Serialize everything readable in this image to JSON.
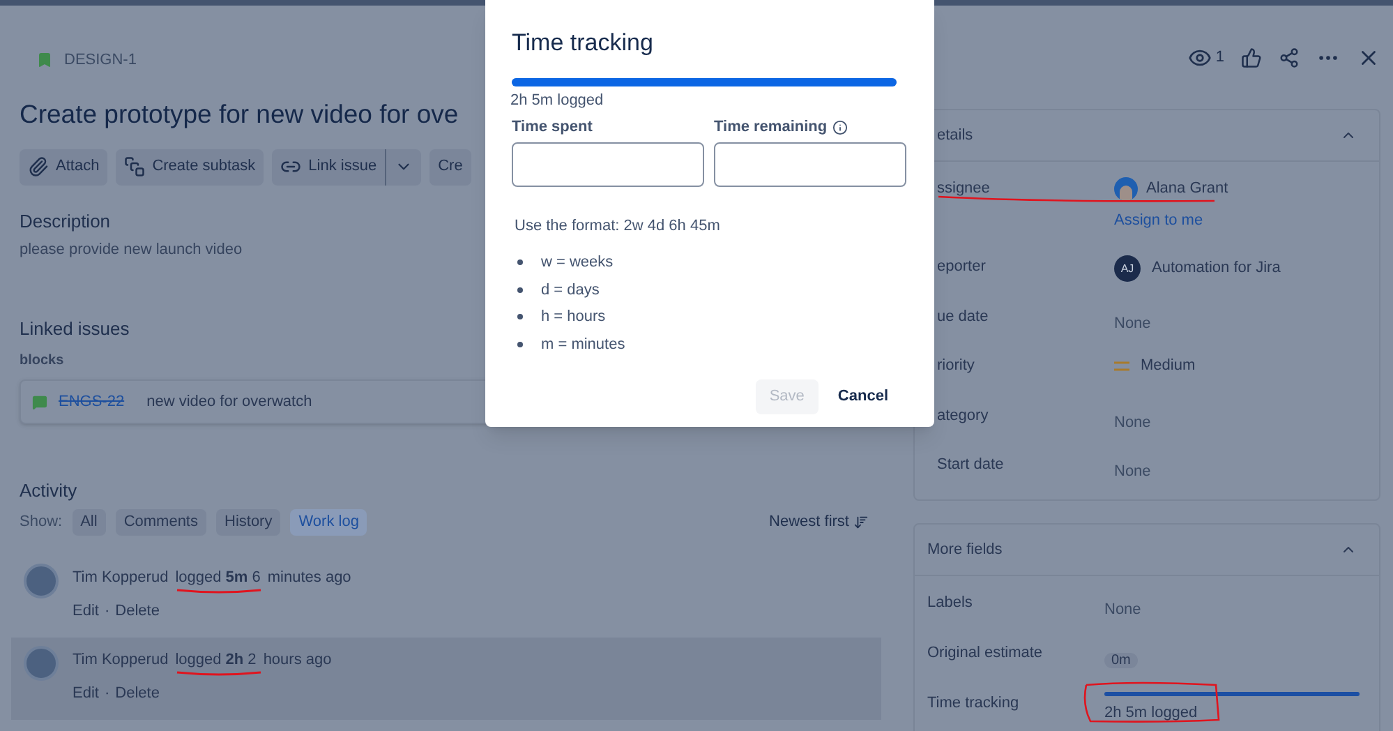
{
  "issue": {
    "key": "DESIGN-1",
    "title": "Create prototype for new video for ove"
  },
  "toolbar": [
    {
      "label": "Attach",
      "kind": "attach",
      "has_menu": false
    },
    {
      "label": "Create subtask",
      "kind": "subtask",
      "has_menu": false
    },
    {
      "label": "Link issue",
      "kind": "link",
      "has_menu": true
    },
    {
      "label": "Cre",
      "kind": "plain",
      "has_menu": false
    }
  ],
  "description": {
    "heading": "Description",
    "text": "please provide new launch video"
  },
  "linked_issues": {
    "heading": "Linked issues",
    "relation": "blocks",
    "items": [
      {
        "key": "ENGS-22",
        "summary": "new video for overwatch",
        "done": true
      }
    ]
  },
  "activity": {
    "heading": "Activity",
    "show_label": "Show:",
    "sort": "Newest first",
    "separator": "·",
    "filters": [
      {
        "label": "All",
        "selected": false
      },
      {
        "label": "Comments",
        "selected": false
      },
      {
        "label": "History",
        "selected": false
      },
      {
        "label": "Work log",
        "selected": true
      }
    ],
    "entries": [
      {
        "author": "Tim Kopperud",
        "action": "logged **5m** 6",
        "rest": "minutes ago",
        "underlined": true,
        "actions": [
          "Edit",
          "Delete"
        ]
      },
      {
        "author": "Tim Kopperud",
        "action": "logged **2h** 2",
        "rest": "hours ago",
        "underlined": true,
        "highlighted": true,
        "actions": [
          "Edit",
          "Delete"
        ]
      }
    ]
  },
  "header_actions": {
    "watchers": "1"
  },
  "details": {
    "heading": "etails",
    "expanded": true,
    "fields": [
      {
        "label": "ssignee",
        "kind": "user",
        "value": "Alana Grant",
        "link": "Assign to me",
        "underlined": true
      },
      {
        "label": "eporter",
        "kind": "initials",
        "initials": "AJ",
        "value": "Automation for Jira"
      },
      {
        "label": "ue date",
        "kind": "text",
        "value": "None"
      },
      {
        "label": "riority",
        "kind": "priority",
        "value": "Medium"
      },
      {
        "label": "ategory",
        "kind": "text",
        "value": "None"
      },
      {
        "label": "Start date",
        "kind": "text",
        "value": "None"
      }
    ]
  },
  "more_fields": {
    "heading": "More fields",
    "expanded": true,
    "fields": [
      {
        "label": "Labels",
        "kind": "text",
        "value": "None"
      },
      {
        "label": "Original estimate",
        "kind": "badge",
        "value": "0m"
      },
      {
        "label": "Time tracking",
        "kind": "progress",
        "level": 1,
        "value": "2h 5m logged",
        "circled": true
      }
    ]
  },
  "modal": {
    "title": "Time tracking",
    "level": 1,
    "logged": "2h 5m logged",
    "fields": [
      {
        "label": "Time spent"
      },
      {
        "label": "Time remaining",
        "info": true
      }
    ],
    "hint": "Use the format: 2w 4d 6h 45m",
    "units": [
      "w = weeks",
      "d = days",
      "h = hours",
      "m = minutes"
    ],
    "buttons": [
      {
        "label": "Save",
        "disabled": true
      },
      {
        "label": "Cancel",
        "disabled": false
      }
    ]
  }
}
